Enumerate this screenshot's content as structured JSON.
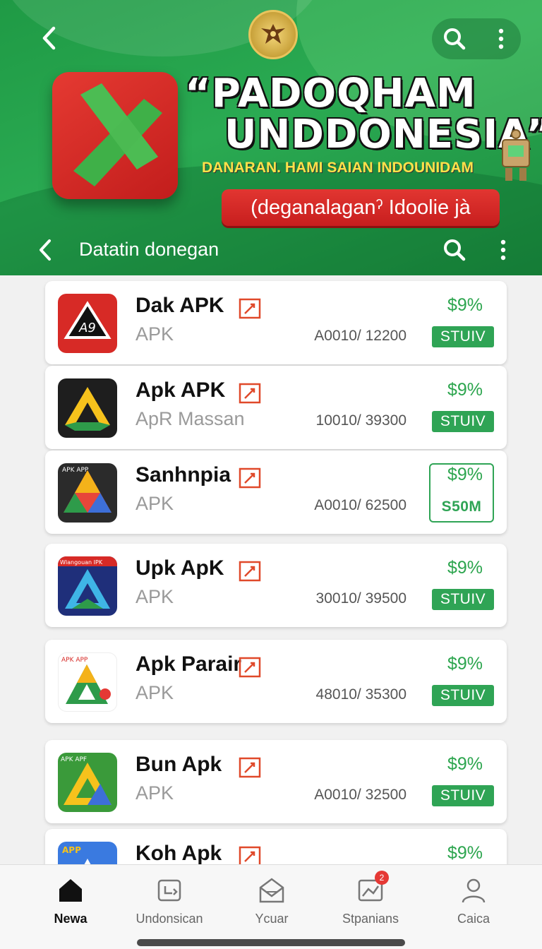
{
  "banner": {
    "title_line1": "“PADOQHAM",
    "title_line2": "UNDDONESIA”",
    "subtitle": "DANARAN. HAMI SAIAN INDOUNIDAM",
    "cta_label": "(deganalaganˀ Idoolie jà",
    "nav_title": "Datatin donegan",
    "icons": {
      "back": "back-arrow-icon",
      "emblem": "eagle-emblem-icon",
      "search": "search-icon",
      "more": "more-vert-icon"
    },
    "colors": {
      "green": "#24a04b",
      "red": "#d42a26",
      "yellow": "#ffe24a"
    }
  },
  "apps": [
    {
      "name": "Dak APK",
      "category": "APK",
      "meta": "A0010/ 12200",
      "price": "$9%",
      "action": "STUIV",
      "icon_text": "A9"
    },
    {
      "name": "Apk APK",
      "category": "ApR Massan",
      "meta": "10010/ 39300",
      "price": "$9%",
      "action": "STUIV",
      "icon_text": ""
    },
    {
      "name": "Sanhnpia",
      "category": "APK",
      "meta": "A0010/ 62500",
      "price": "$9%",
      "action": "S50M",
      "icon_text": "APK   APP"
    },
    {
      "name": "Upk ApK",
      "category": "APK",
      "meta": "30010/ 39500",
      "price": "$9%",
      "action": "STUIV",
      "icon_text": "Wlangouan IPK"
    },
    {
      "name": "Apk Parair",
      "category": "APK",
      "meta": "48010/ 35300",
      "price": "$9%",
      "action": "STUIV",
      "icon_text": "APK   APP"
    },
    {
      "name": "Bun Apk",
      "category": "APK",
      "meta": "A0010/ 32500",
      "price": "$9%",
      "action": "STUIV",
      "icon_text": "APK   APF"
    },
    {
      "name": "Koh Apk",
      "category": "",
      "meta": "",
      "price": "$9%",
      "action": "",
      "icon_text": "APP"
    }
  ],
  "bottom_nav": [
    {
      "label": "Newa",
      "icon": "home-icon",
      "active": true
    },
    {
      "label": "Undonsican",
      "icon": "download-box-icon",
      "active": false
    },
    {
      "label": "Ycuar",
      "icon": "mail-icon",
      "active": false
    },
    {
      "label": "Stpanians",
      "icon": "chart-icon",
      "active": false,
      "badge": "2"
    },
    {
      "label": "Caica",
      "icon": "person-icon",
      "active": false
    }
  ]
}
